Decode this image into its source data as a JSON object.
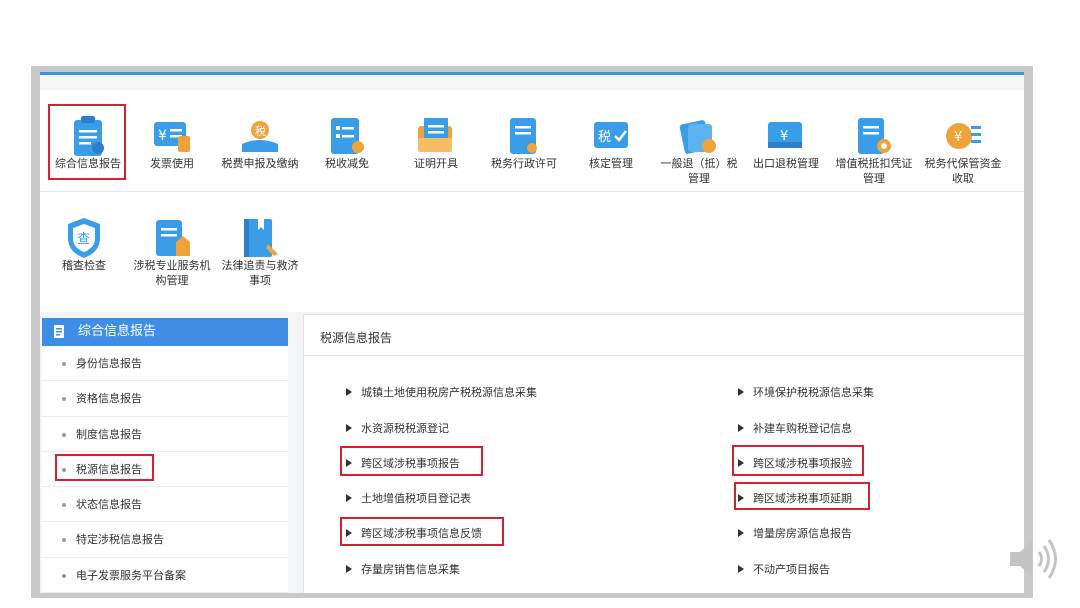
{
  "icons_row1": [
    {
      "label": "综合信息报告",
      "icon": "report-icon"
    },
    {
      "label": "发票使用",
      "icon": "invoice-icon"
    },
    {
      "label": "税费申报及缴纳",
      "icon": "tax-payment-icon"
    },
    {
      "label": "税收减免",
      "icon": "tax-relief-icon"
    },
    {
      "label": "证明开具",
      "icon": "certificate-icon"
    },
    {
      "label": "税务行政许可",
      "icon": "license-icon"
    },
    {
      "label": "核定管理",
      "icon": "tax-approve-icon"
    },
    {
      "label": "一般退（抵）税管理",
      "icon": "refund-icon"
    },
    {
      "label": "出口退税管理",
      "icon": "export-refund-icon"
    },
    {
      "label": "增值税抵扣凭证管理",
      "icon": "vat-voucher-icon"
    },
    {
      "label": "税务代保管资金收取",
      "icon": "fund-custody-icon"
    }
  ],
  "icons_row2": [
    {
      "label": "稽查检查",
      "icon": "inspection-shield-icon"
    },
    {
      "label": "涉税专业服务机构管理",
      "icon": "agency-icon"
    },
    {
      "label": "法律追责与救济事项",
      "icon": "law-book-icon"
    }
  ],
  "menu": {
    "title": "综合信息报告",
    "items": [
      "身份信息报告",
      "资格信息报告",
      "制度信息报告",
      "税源信息报告",
      "状态信息报告",
      "特定涉税信息报告",
      "电子发票服务平台备案"
    ]
  },
  "content": {
    "title": "税源信息报告",
    "left_links": [
      "城镇土地使用税房产税税源信息采集",
      "水资源税税源登记",
      "跨区域涉税事项报告",
      "土地增值税项目登记表",
      "跨区域涉税事项信息反馈",
      "存量房销售信息采集"
    ],
    "right_links": [
      "环境保护税税源信息采集",
      "补建车购税登记信息",
      "跨区域涉税事项报验",
      "跨区域涉税事项延期",
      "增量房房源信息报告",
      "不动产项目报告"
    ]
  },
  "colors": {
    "accent": "#3f8ee6",
    "highlight": "#d4202f"
  }
}
